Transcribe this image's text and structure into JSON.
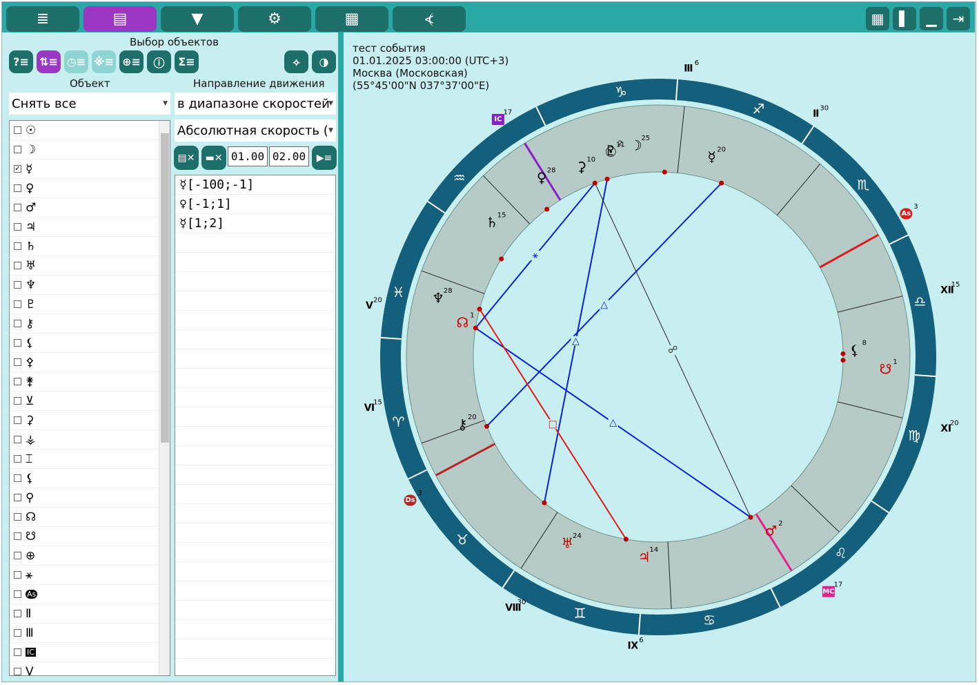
{
  "toolbar": {
    "left_buttons": [
      {
        "icon": "list-icon",
        "glyph": "≣"
      },
      {
        "icon": "objects-icon",
        "glyph": "▤",
        "active": true
      },
      {
        "icon": "filter-down-icon",
        "glyph": "▼"
      },
      {
        "icon": "gear-icon",
        "glyph": "⚙"
      },
      {
        "icon": "table-icon",
        "glyph": "▦"
      },
      {
        "icon": "logo-icon",
        "glyph": "⦓"
      }
    ],
    "right_buttons": [
      {
        "icon": "grid-icon",
        "glyph": "▦"
      },
      {
        "icon": "panel-icon",
        "glyph": "▌"
      },
      {
        "icon": "minimize-icon",
        "glyph": "▁"
      },
      {
        "icon": "exit-icon",
        "glyph": "⇥"
      }
    ]
  },
  "left": {
    "section_title": "Выбор объектов",
    "object_label": "Объект",
    "direction_label": "Направление движения",
    "object_select": "Снять все",
    "direction_select": "в диапазоне скоростей",
    "speed_select": "Абсолютная скорость (",
    "range_from": "01.00",
    "range_to": "02.00",
    "objects": [
      {
        "glyph": "☉",
        "checked": false
      },
      {
        "glyph": "☽",
        "checked": false
      },
      {
        "glyph": "☿",
        "checked": true
      },
      {
        "glyph": "♀",
        "checked": false
      },
      {
        "glyph": "♂",
        "checked": false
      },
      {
        "glyph": "♃",
        "checked": false
      },
      {
        "glyph": "♄",
        "checked": false
      },
      {
        "glyph": "♅",
        "checked": false
      },
      {
        "glyph": "♆",
        "checked": false
      },
      {
        "glyph": "♇",
        "checked": false
      },
      {
        "glyph": "⚷",
        "checked": false
      },
      {
        "glyph": "⚸",
        "checked": false
      },
      {
        "glyph": "⚴",
        "checked": false
      },
      {
        "glyph": "⚵",
        "checked": false
      },
      {
        "glyph": "⊻",
        "checked": false
      },
      {
        "glyph": "⚳",
        "checked": false
      },
      {
        "glyph": "⚶",
        "checked": false
      },
      {
        "glyph": "⌶",
        "checked": false
      },
      {
        "glyph": "⚸",
        "checked": false
      },
      {
        "glyph": "⚲",
        "checked": false
      },
      {
        "glyph": "☊",
        "checked": false
      },
      {
        "glyph": "☋",
        "checked": false
      },
      {
        "glyph": "⊕",
        "checked": false
      },
      {
        "glyph": "⚹",
        "checked": false
      },
      {
        "glyph": "As",
        "checked": false
      },
      {
        "glyph": "Ⅱ",
        "checked": false
      },
      {
        "glyph": "Ⅲ",
        "checked": false
      },
      {
        "glyph": "IC",
        "checked": false
      },
      {
        "glyph": "Ⅴ",
        "checked": false
      }
    ],
    "ranges": [
      "☿[-100;-1]",
      "♀[-1;1]",
      "☿[1;2]"
    ]
  },
  "info": {
    "line1": "тест события",
    "line2": "01.01.2025 03:00:00 (UTC+3)",
    "line3": "Москва (Московская)",
    "line4": "(55°45'00\"N 037°37'00\"E)"
  },
  "wheel": {
    "signs": [
      {
        "glyph": "♑",
        "lon": 270
      },
      {
        "glyph": "♐",
        "lon": 240
      },
      {
        "glyph": "♏",
        "lon": 210
      },
      {
        "glyph": "♎",
        "lon": 180
      },
      {
        "glyph": "♍",
        "lon": 150
      },
      {
        "glyph": "♌",
        "lon": 120
      },
      {
        "glyph": "♋",
        "lon": 90
      },
      {
        "glyph": "♊",
        "lon": 60
      },
      {
        "glyph": "♉",
        "lon": 30
      },
      {
        "glyph": "♈",
        "lon": 0
      },
      {
        "glyph": "♓",
        "lon": 330
      },
      {
        "glyph": "♒",
        "lon": 300
      }
    ],
    "houses": [
      {
        "label": "Ⅲ",
        "deg": "6"
      },
      {
        "label": "Ⅱ",
        "deg": "30"
      },
      {
        "label": "Ⅻ",
        "deg": "15"
      },
      {
        "label": "Ⅺ",
        "deg": "20"
      },
      {
        "label": "Ⅸ",
        "deg": "6"
      },
      {
        "label": "Ⅷ",
        "deg": "30"
      },
      {
        "label": "Ⅵ",
        "deg": "15"
      },
      {
        "label": "Ⅴ",
        "deg": "20"
      }
    ],
    "angles": [
      {
        "label": "IC",
        "deg": "17",
        "color": "#8a1fc7"
      },
      {
        "label": "As",
        "deg": "3",
        "color": "#d42020"
      },
      {
        "label": "Ds",
        "deg": "3",
        "color": "#b82525"
      },
      {
        "label": "MC",
        "deg": "17",
        "color": "#e3208f"
      }
    ],
    "planets": [
      {
        "glyph": "☉",
        "deg": "11",
        "color": "#000"
      },
      {
        "glyph": "☿",
        "deg": "20",
        "color": "#000"
      },
      {
        "glyph": "⚳",
        "deg": "10",
        "color": "#000"
      },
      {
        "glyph": "♇",
        "deg": "2",
        "color": "#000"
      },
      {
        "glyph": "☽",
        "deg": "25",
        "color": "#000"
      },
      {
        "glyph": "♀",
        "deg": "28",
        "color": "#000"
      },
      {
        "glyph": "♄",
        "deg": "15",
        "color": "#000"
      },
      {
        "glyph": "♆",
        "deg": "28",
        "color": "#000"
      },
      {
        "glyph": "☊",
        "deg": "1",
        "color": "#c00"
      },
      {
        "glyph": "⚷",
        "deg": "20",
        "color": "#000"
      },
      {
        "glyph": "♅",
        "deg": "24",
        "color": "#c00"
      },
      {
        "glyph": "♃",
        "deg": "14",
        "color": "#c00"
      },
      {
        "glyph": "♂",
        "deg": "2",
        "color": "#c00"
      },
      {
        "glyph": "⚸",
        "deg": "8",
        "color": "#000"
      },
      {
        "glyph": "☋",
        "deg": "1",
        "color": "#c00"
      }
    ],
    "colors": {
      "outer": "#145f7b",
      "house": "#b6cac6",
      "bg": "#c7eef0",
      "blue": "#0a22d6",
      "red": "#e01818"
    }
  }
}
